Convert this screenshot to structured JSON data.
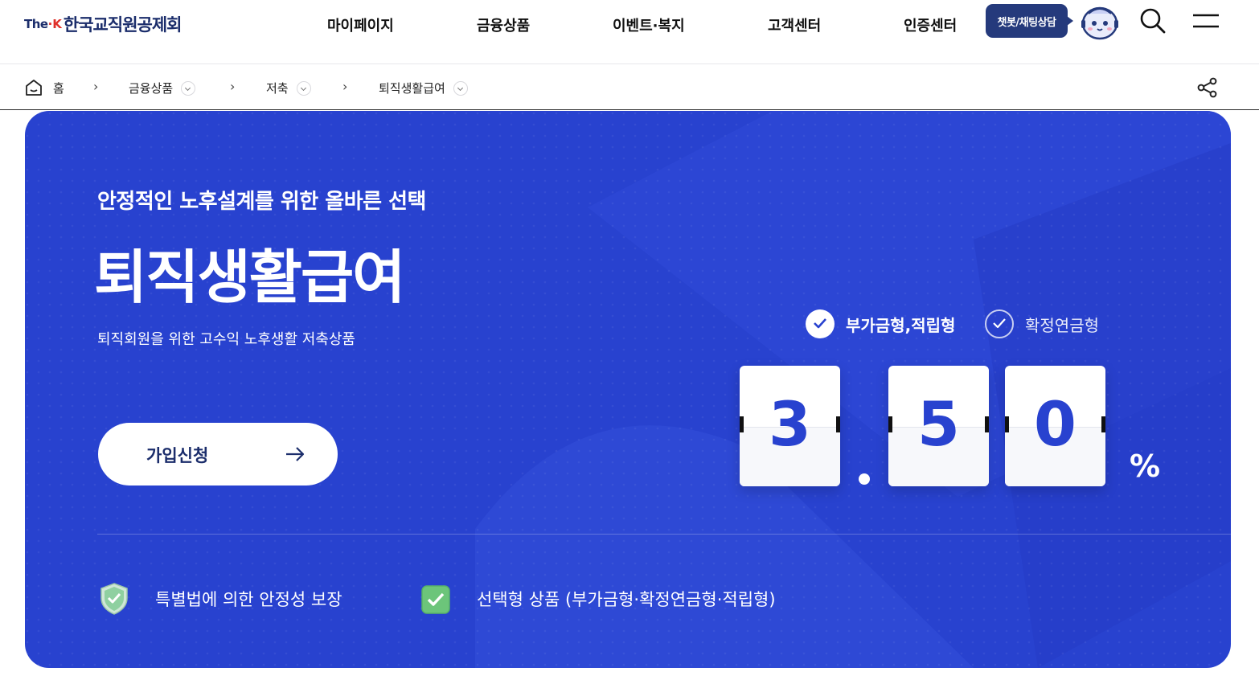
{
  "header": {
    "logo": {
      "prefix": "The",
      "k": "·K",
      "name": "한국교직원공제회"
    },
    "nav": [
      "마이페이지",
      "금융상품",
      "이벤트·복지",
      "고객센터",
      "인증센터"
    ],
    "chat_label": "챗봇/채팅상담",
    "icons": {
      "mascot": "chatbot-mascot-icon",
      "search": "search-icon",
      "menu": "hamburger-menu-icon"
    }
  },
  "breadcrumb": {
    "items": [
      "홈",
      "금융상품",
      "저축",
      "퇴직생활급여"
    ],
    "icons": {
      "home": "home-icon",
      "share": "share-icon"
    }
  },
  "hero": {
    "eyebrow": "안정적인 노후설계를 위한 올바른 선택",
    "title": "퇴직생활급여",
    "description": "퇴직회원을 위한 고수익 노후생활 저축상품",
    "apply_label": "가입신청",
    "types": [
      {
        "label": "부가금형,적립형",
        "checked": true
      },
      {
        "label": "확정연금형",
        "checked": false
      }
    ],
    "rate": {
      "digits": [
        "3",
        "5",
        "0"
      ],
      "percent": "%",
      "value": "3.50"
    },
    "features": [
      {
        "label": "특별법에 의한 안정성 보장",
        "icon": "shield-check-icon"
      },
      {
        "label": "선택형 상품 (부가금형·확정연금형·적립형)",
        "icon": "checkbox-checked-icon"
      }
    ],
    "colors": {
      "background": "#2842cf",
      "brand_navy": "#1b2d6b",
      "digit_text": "#2842cf"
    }
  }
}
